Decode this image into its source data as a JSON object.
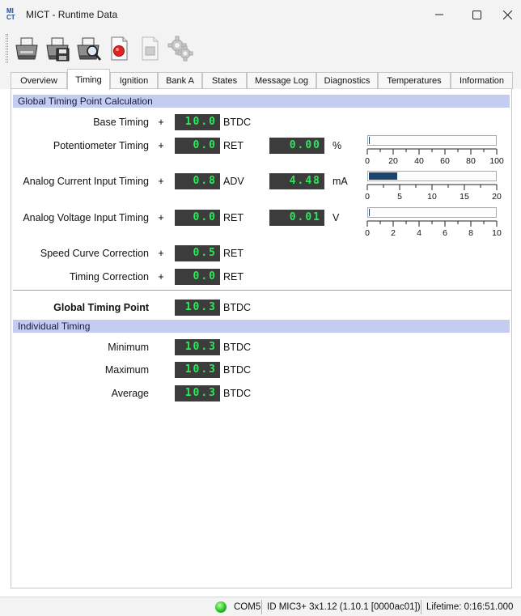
{
  "window": {
    "title": "MICT - Runtime Data",
    "icon_text_top": "MI",
    "icon_text_bottom": "CT",
    "minimize_icon": "minimize-icon",
    "maximize_icon": "maximize-icon",
    "close_icon": "close-icon"
  },
  "toolbar": {
    "buttons": [
      {
        "icon": "printer-icon",
        "enabled": true
      },
      {
        "icon": "printer-save-icon",
        "enabled": true
      },
      {
        "icon": "printer-preview-icon",
        "enabled": true
      },
      {
        "icon": "record-icon",
        "enabled": true,
        "color": "#e02424"
      },
      {
        "icon": "stop-icon",
        "enabled": false
      },
      {
        "icon": "settings-gear-icon",
        "enabled": false
      }
    ]
  },
  "tabs": [
    {
      "label": "Overview",
      "active": false
    },
    {
      "label": "Timing",
      "active": true
    },
    {
      "label": "Ignition",
      "active": false
    },
    {
      "label": "Bank A",
      "active": false
    },
    {
      "label": "States",
      "active": false
    },
    {
      "label": "Message Log",
      "active": false
    },
    {
      "label": "Diagnostics",
      "active": false
    },
    {
      "label": "Temperatures",
      "active": false
    },
    {
      "label": "Information",
      "active": false
    }
  ],
  "global_calc": {
    "header": "Global Timing Point Calculation",
    "plus": "+",
    "rows": [
      {
        "label": "Base Timing",
        "value": "10.0",
        "unit": "BTDC"
      },
      {
        "label": "Potentiometer Timing",
        "value": "0.0",
        "unit": "RET",
        "input_value": "0.00",
        "input_unit": "%"
      },
      {
        "label": "Analog Current Input Timing",
        "value": "0.8",
        "unit": "ADV",
        "input_value": "4.48",
        "input_unit": "mA"
      },
      {
        "label": "Analog Voltage Input Timing",
        "value": "0.0",
        "unit": "RET",
        "input_value": "0.01",
        "input_unit": "V"
      },
      {
        "label": "Speed Curve Correction",
        "value": "0.5",
        "unit": "RET"
      },
      {
        "label": "Timing Correction",
        "value": "0.0",
        "unit": "RET"
      }
    ],
    "gauges": [
      {
        "name": "potentiometer",
        "ticks": [
          "0",
          "20",
          "40",
          "60",
          "80",
          "100"
        ],
        "fill_fraction": 0.0,
        "bar_color": "#1b4471"
      },
      {
        "name": "analog-current",
        "ticks": [
          "0",
          "5",
          "10",
          "15",
          "20"
        ],
        "fill_fraction": 0.224,
        "bar_color": "#1b4471"
      },
      {
        "name": "analog-voltage",
        "ticks": [
          "0",
          "2",
          "4",
          "6",
          "8",
          "10"
        ],
        "fill_fraction": 0.001,
        "bar_color": "#1b4471"
      }
    ],
    "result": {
      "label": "Global Timing Point",
      "value": "10.3",
      "unit": "BTDC"
    }
  },
  "individual": {
    "header": "Individual Timing",
    "rows": [
      {
        "label": "Minimum",
        "value": "10.3",
        "unit": "BTDC"
      },
      {
        "label": "Maximum",
        "value": "10.3",
        "unit": "BTDC"
      },
      {
        "label": "Average",
        "value": "10.3",
        "unit": "BTDC"
      }
    ]
  },
  "status": {
    "port": "COM5",
    "id": "ID MIC3+ 3x1.12 (1.10.1 [0000ac01])",
    "lifetime": "Lifetime: 0:16:51.000",
    "connection_color": "#27c22a"
  },
  "colors": {
    "header_bg": "#c4ccf0",
    "lcd_bg": "#3c3c3c",
    "lcd_text": "#2ee85c"
  }
}
